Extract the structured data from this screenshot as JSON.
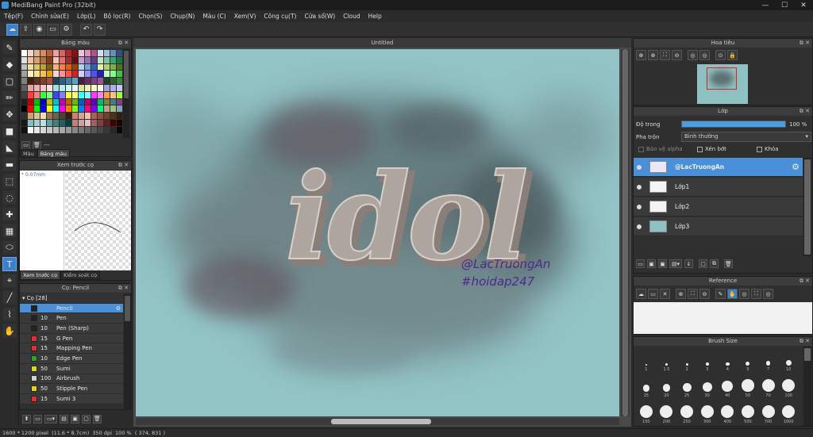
{
  "window": {
    "title": "MediBang Paint Pro (32bit)",
    "minimize": "—",
    "maximize": "☐",
    "close": "✕"
  },
  "menu": [
    "Tệp(F)",
    "Chỉnh sửa(E)",
    "Lớp(L)",
    "Bộ lọc(R)",
    "Chọn(S)",
    "Chụp(N)",
    "Màu (C)",
    "Xem(V)",
    "Công cụ(T)",
    "Cửa sổ(W)",
    "Cloud",
    "Help"
  ],
  "toolbar": {
    "icons": [
      "cloud-icon",
      "export-icon",
      "chat-icon",
      "message-icon",
      "settings-icon",
      "layers-icon",
      "undo-icon",
      "redo-icon"
    ],
    "glyphs": [
      "☁",
      "⇪",
      "◉",
      "▭",
      "⚙",
      "▤",
      "↶",
      "↷"
    ]
  },
  "tools": {
    "glyphs": [
      "✎",
      "◆",
      "▢",
      "✏",
      "✥",
      "■",
      "◣",
      "▬",
      "⬚",
      "◌",
      "✚",
      "▦",
      "⬭",
      "T",
      "⌖",
      "╱",
      "⌇",
      "✋"
    ],
    "selected_index": 13
  },
  "color_panel": {
    "title": "Bảng màu",
    "bar_text": "---",
    "tabs": [
      "Màu",
      "Bảng màu"
    ],
    "active_tab": 1,
    "swatches": [
      "#ffffff",
      "#f4d6c8",
      "#e8b08a",
      "#d98b5a",
      "#c06030",
      "#f0a0a0",
      "#e06060",
      "#c02020",
      "#8a1010",
      "#f0c0e0",
      "#e090c0",
      "#b05090",
      "#d0e0f0",
      "#a0c0e0",
      "#6090c0",
      "#305080",
      "#e0e0e0",
      "#f2c2a0",
      "#d8a070",
      "#b07040",
      "#804020",
      "#f8c0b0",
      "#e07070",
      "#a03030",
      "#601010",
      "#c0a0d0",
      "#9070b0",
      "#604080",
      "#c0e0d0",
      "#80c0a0",
      "#40a070",
      "#207040",
      "#c0c0c0",
      "#f0e0a0",
      "#e0c060",
      "#c0a030",
      "#806010",
      "#ffb080",
      "#ff8040",
      "#e06010",
      "#a04000",
      "#b0d0f0",
      "#70a0e0",
      "#3060c0",
      "#e0f0b0",
      "#b0d070",
      "#80b040",
      "#507020",
      "#a0a0a0",
      "#fff0c0",
      "#ffe080",
      "#ffc040",
      "#e0a000",
      "#ffd0d0",
      "#ff9090",
      "#ff5050",
      "#d02020",
      "#d0d0ff",
      "#9090ff",
      "#5050ff",
      "#2020c0",
      "#c0ffc0",
      "#80ff80",
      "#40c040",
      "#808080",
      "#402010",
      "#603020",
      "#804030",
      "#a05040",
      "#204060",
      "#306080",
      "#4080a0",
      "#60a0c0",
      "#402040",
      "#603060",
      "#804080",
      "#a050a0",
      "#204020",
      "#306030",
      "#408040",
      "#606060",
      "#e8a0a0",
      "#f0b0b0",
      "#f8c8c8",
      "#ffe0e0",
      "#a0e0e0",
      "#b0f0f0",
      "#c8f8f8",
      "#e0ffff",
      "#e0e0a0",
      "#f0f0b0",
      "#f8f8c8",
      "#ffffe0",
      "#a0a0e0",
      "#b0b0f0",
      "#c8c8f8",
      "#404040",
      "#ff4040",
      "#ff8080",
      "#40ff40",
      "#80ff80",
      "#4040ff",
      "#8080ff",
      "#ffff40",
      "#ffff80",
      "#40ffff",
      "#80ffff",
      "#ff40ff",
      "#ff80ff",
      "#ffa040",
      "#ffc080",
      "#a0ff40",
      "#202020",
      "#c00000",
      "#00c000",
      "#0000c0",
      "#c0c000",
      "#00c0c0",
      "#c000c0",
      "#c06000",
      "#60c000",
      "#0060c0",
      "#c00060",
      "#6000c0",
      "#00c060",
      "#808040",
      "#408080",
      "#804080",
      "#000000",
      "#ff0000",
      "#00ff00",
      "#0000ff",
      "#ffff00",
      "#00ffff",
      "#ff00ff",
      "#ff8000",
      "#80ff00",
      "#0080ff",
      "#ff0080",
      "#8000ff",
      "#00ff80",
      "#c0a080",
      "#a0c080",
      "#80a0c0",
      "#303030",
      "#d0a070",
      "#e0c090",
      "#f0e0b0",
      "#a07050",
      "#706050",
      "#504030",
      "#302010",
      "#d08070",
      "#e0a090",
      "#f0c0b0",
      "#b06050",
      "#905040",
      "#704030",
      "#503020",
      "#302010",
      "#181818",
      "#80c0c0",
      "#a0d0d0",
      "#c0e0e0",
      "#60a0a0",
      "#408080",
      "#206060",
      "#004040",
      "#c08080",
      "#d0a0a0",
      "#e0c0c0",
      "#a06060",
      "#804040",
      "#602020",
      "#400000",
      "#200000",
      "#101010",
      "#f8f8f8",
      "#e8e8e8",
      "#d8d8d8",
      "#c8c8c8",
      "#b8b8b8",
      "#a8a8a8",
      "#989898",
      "#888888",
      "#787878",
      "#686868",
      "#585858",
      "#484848",
      "#383838",
      "#282828",
      "#080808"
    ]
  },
  "preview_panel": {
    "title": "Xem trước cọ",
    "size_label": "* 0.07mm",
    "tabs": [
      "Xem trước cọ",
      "Kiểm soát cọ"
    ],
    "active_tab": 0
  },
  "brush_panel": {
    "title": "Cọ: Pencil",
    "group": "Cọ [28]",
    "items": [
      {
        "size": "",
        "name": "Pencil",
        "color": "#222222"
      },
      {
        "size": "10",
        "name": "Pen",
        "color": "#222222"
      },
      {
        "size": "10",
        "name": "Pen (Sharp)",
        "color": "#222222"
      },
      {
        "size": "15",
        "name": "G Pen",
        "color": "#e03030"
      },
      {
        "size": "15",
        "name": "Mapping Pen",
        "color": "#e03030"
      },
      {
        "size": "10",
        "name": "Edge Pen",
        "color": "#30a030"
      },
      {
        "size": "50",
        "name": "Sumi",
        "color": "#e0d020"
      },
      {
        "size": "100",
        "name": "Airbrush",
        "color": "#d0d0d0"
      },
      {
        "size": "50",
        "name": "Stipple Pen",
        "color": "#e0d020"
      },
      {
        "size": "15",
        "name": "Sumi 3",
        "color": "#e03030"
      }
    ],
    "selected_index": 0,
    "bar_glyphs": [
      "⬆",
      "▭",
      "▭▾",
      "▤",
      "▣",
      "▢",
      "🗑"
    ]
  },
  "canvas": {
    "doc_title": "Untitled",
    "artwork_text": "idol",
    "watermark_line1": "@LacTruongAn",
    "watermark_line2": "#hoidap247"
  },
  "navigator": {
    "title": "Hoa tiêu",
    "glyphs": [
      "⊕",
      "⊕",
      "⛶",
      "⊖",
      "◎",
      "◎",
      "⊙",
      "🔒"
    ]
  },
  "layer_panel": {
    "title": "Lớp",
    "opacity_label": "Độ trong",
    "opacity_value": "100 %",
    "opacity_fraction": 1.0,
    "blend_label": "Pha trộn",
    "blend_value": "Bình thường",
    "protect_alpha": "Bảo vệ alpha",
    "clipping": "Xén bớt",
    "lock": "Khóa",
    "layers": [
      {
        "name": "@LacTruongAn",
        "thumb": "#e8e8f8"
      },
      {
        "name": "Lớp1",
        "thumb": "#f4f4f4"
      },
      {
        "name": "Lớp2",
        "thumb": "#f4f4f4"
      },
      {
        "name": "Lớp3",
        "thumb": "#8fc1c3"
      }
    ],
    "selected_index": 0,
    "bar_glyphs": [
      "▭",
      "▣",
      "▣",
      "▤▾",
      "⇓",
      "▢",
      "⧉",
      "🗑"
    ]
  },
  "reference_panel": {
    "title": "Reference",
    "glyphs": [
      "☁",
      "▭",
      "✕",
      "⊕",
      "⛶",
      "⊖",
      "✎",
      "✋",
      "◎",
      "⛶",
      "◎"
    ]
  },
  "brush_size_panel": {
    "title": "Brush Size",
    "sizes": [
      "1",
      "1.5",
      "2",
      "3",
      "4",
      "5",
      "7",
      "10",
      "15",
      "20",
      "25",
      "30",
      "40",
      "50",
      "70",
      "100",
      "150",
      "200",
      "250",
      "300",
      "400",
      "500",
      "700",
      "1000"
    ]
  },
  "status": {
    "dimensions": "1600 * 1200 pixel",
    "physical": "(11.6 * 8.7cm)",
    "dpi": "350 dpi",
    "zoom": "100 %",
    "cursor": "( 374, 831 )"
  }
}
